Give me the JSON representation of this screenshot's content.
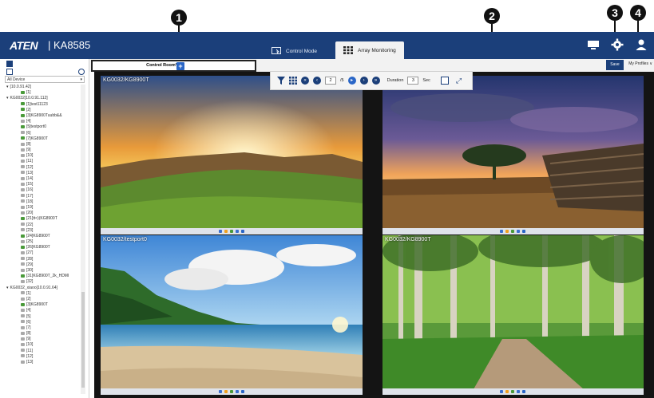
{
  "callouts": [
    "1",
    "2",
    "3",
    "4"
  ],
  "header": {
    "logo": "ATEN",
    "product": "| KA8585",
    "tabs": [
      {
        "label": "Control Mode",
        "active": false
      },
      {
        "label": "Array Monitoring",
        "active": true
      }
    ],
    "icons": [
      "monitor-icon",
      "gear-icon",
      "user-icon"
    ]
  },
  "left_panel": {
    "device_filter": "All Device",
    "tree": [
      {
        "label": "[10.0.91.42]",
        "level": 0,
        "expander": "▾"
      },
      {
        "label": "[1]",
        "level": 1,
        "on": true
      },
      {
        "label": "KG0032[10.0.91.112]",
        "level": 0,
        "expander": "▾"
      },
      {
        "label": "[1]test11123",
        "level": 1,
        "on": true
      },
      {
        "label": "[2]",
        "level": 1,
        "on": true
      },
      {
        "label": "[3]KG8900Tuubb&&",
        "level": 1,
        "on": true
      },
      {
        "label": "[4]",
        "level": 1,
        "on": false
      },
      {
        "label": "[5]testport0",
        "level": 1,
        "on": true
      },
      {
        "label": "[6]",
        "level": 1,
        "on": false
      },
      {
        "label": "[7]KG8900T",
        "level": 1,
        "on": true
      },
      {
        "label": "[8]",
        "level": 1,
        "on": false
      },
      {
        "label": "[9]",
        "level": 1,
        "on": false
      },
      {
        "label": "[10]",
        "level": 1,
        "on": false
      },
      {
        "label": "[11]",
        "level": 1,
        "on": false
      },
      {
        "label": "[12]",
        "level": 1,
        "on": false
      },
      {
        "label": "[13]",
        "level": 1,
        "on": false
      },
      {
        "label": "[14]",
        "level": 1,
        "on": false
      },
      {
        "label": "[15]",
        "level": 1,
        "on": false
      },
      {
        "label": "[16]",
        "level": 1,
        "on": false
      },
      {
        "label": "[17]",
        "level": 1,
        "on": false
      },
      {
        "label": "[18]",
        "level": 1,
        "on": false
      },
      {
        "label": "[19]",
        "level": 1,
        "on": false
      },
      {
        "label": "[20]",
        "level": 1,
        "on": false
      },
      {
        "label": "[21]tt<)(KG8900T",
        "level": 1,
        "on": true
      },
      {
        "label": "[22]",
        "level": 1,
        "on": false
      },
      {
        "label": "[23]",
        "level": 1,
        "on": false
      },
      {
        "label": "[24]KG8900T",
        "level": 1,
        "on": true
      },
      {
        "label": "[25]",
        "level": 1,
        "on": false
      },
      {
        "label": "[26]KG8900T",
        "level": 1,
        "on": true
      },
      {
        "label": "[27]",
        "level": 1,
        "on": false
      },
      {
        "label": "[28]",
        "level": 1,
        "on": false
      },
      {
        "label": "[29]",
        "level": 1,
        "on": false
      },
      {
        "label": "[30]",
        "level": 1,
        "on": false
      },
      {
        "label": "[31]KG8900T_2k_HDMI",
        "level": 1,
        "on": true
      },
      {
        "label": "[32]",
        "level": 1,
        "on": false
      },
      {
        "label": "KG0032_xiaoo[10.0.91.64]",
        "level": 0,
        "expander": "▾"
      },
      {
        "label": "[1]",
        "level": 1,
        "on": false
      },
      {
        "label": "[2]",
        "level": 1,
        "on": false
      },
      {
        "label": "[3]KG8900T",
        "level": 1,
        "on": true
      },
      {
        "label": "[4]",
        "level": 1,
        "on": false
      },
      {
        "label": "[5]",
        "level": 1,
        "on": false
      },
      {
        "label": "[6]",
        "level": 1,
        "on": false
      },
      {
        "label": "[7]",
        "level": 1,
        "on": false
      },
      {
        "label": "[8]",
        "level": 1,
        "on": false
      },
      {
        "label": "[9]",
        "level": 1,
        "on": false
      },
      {
        "label": "[10]",
        "level": 1,
        "on": false
      },
      {
        "label": "[11]",
        "level": 1,
        "on": false
      },
      {
        "label": "[12]",
        "level": 1,
        "on": false
      },
      {
        "label": "[13]",
        "level": 1,
        "on": false
      }
    ]
  },
  "subbar": {
    "control_room_tab": "Control Room*",
    "add_label": "+",
    "save_label": "Save",
    "profiles_label": "My Profiles ∨"
  },
  "toolbar": {
    "page_current": "2",
    "page_total": "/5",
    "duration_label": "Duration",
    "duration_value": "3",
    "duration_unit": "Sec"
  },
  "panes": [
    {
      "label": "KG0032/KG8900T"
    },
    {
      "label": ""
    },
    {
      "label": "KG0032/testport0"
    },
    {
      "label": "KG0032/KG8900T"
    }
  ],
  "colors": {
    "header": "#1b3f7a",
    "accent": "#2a66c7",
    "port_online": "#4a9a3a",
    "port_offline": "#a9a9a9"
  }
}
